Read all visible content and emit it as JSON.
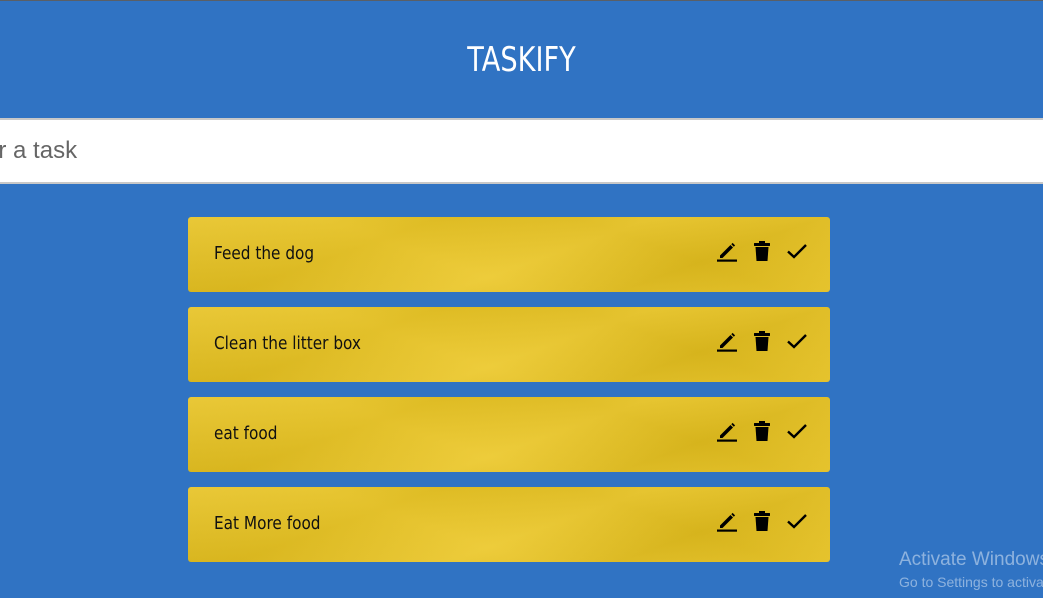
{
  "app": {
    "title": "TASKIFY"
  },
  "input": {
    "value": "",
    "placeholder": "Enter a task"
  },
  "tasks": [
    {
      "text": "Feed the dog"
    },
    {
      "text": "Clean the litter box"
    },
    {
      "text": "eat food"
    },
    {
      "text": "Eat More food"
    }
  ],
  "icons": {
    "edit": "edit-icon",
    "delete": "trash-icon",
    "done": "check-icon"
  },
  "colors": {
    "background": "#3073c3",
    "card": "#ebc51f",
    "input_bg": "#ffffff"
  },
  "watermark": {
    "line1": "Activate Windows",
    "line2": "Go to Settings to activate Windows."
  }
}
